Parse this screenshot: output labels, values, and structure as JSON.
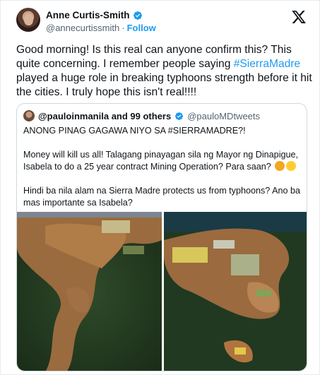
{
  "post": {
    "author_name": "Anne Curtis-Smith",
    "author_handle": "@annecurtissmith",
    "separator": "·",
    "follow_label": "Follow",
    "text_before": "Good morning! Is this real can anyone confirm this? This quite concerning. I remember people saying ",
    "hashtag": "#SierraMadre",
    "text_after": " played a huge role in breaking typhoons strength before it hit the cities. I truly hope this isn't real!!!!",
    "logo_icon": "x-logo-icon",
    "verified_icon": "verified-badge-icon"
  },
  "quote": {
    "author_name": "@pauloinmanila and 99 others",
    "author_handle": "@pauloMDtweets",
    "line1": "ANONG PINAG GAGAWA NIYO SA #SIERRAMADRE?!",
    "line2": "Money will kill us all! Talagang pinayagan sila ng Mayor ng Dinapigue, Isabela to do a 25 year contract Mining Operation? Para saan?",
    "line3": "Hindi ba nila alam na Sierra Madre protects us from typhoons? Ano ba mas importante sa Isabela?",
    "emojis": [
      "hugging-face-icon",
      "weary-face-icon"
    ],
    "images": [
      "aerial-mining-photo-left",
      "aerial-mining-photo-right"
    ]
  },
  "colors": {
    "accent": "#1d9bf0",
    "text": "#0f1419",
    "muted": "#536471",
    "border": "#cfd9de"
  }
}
